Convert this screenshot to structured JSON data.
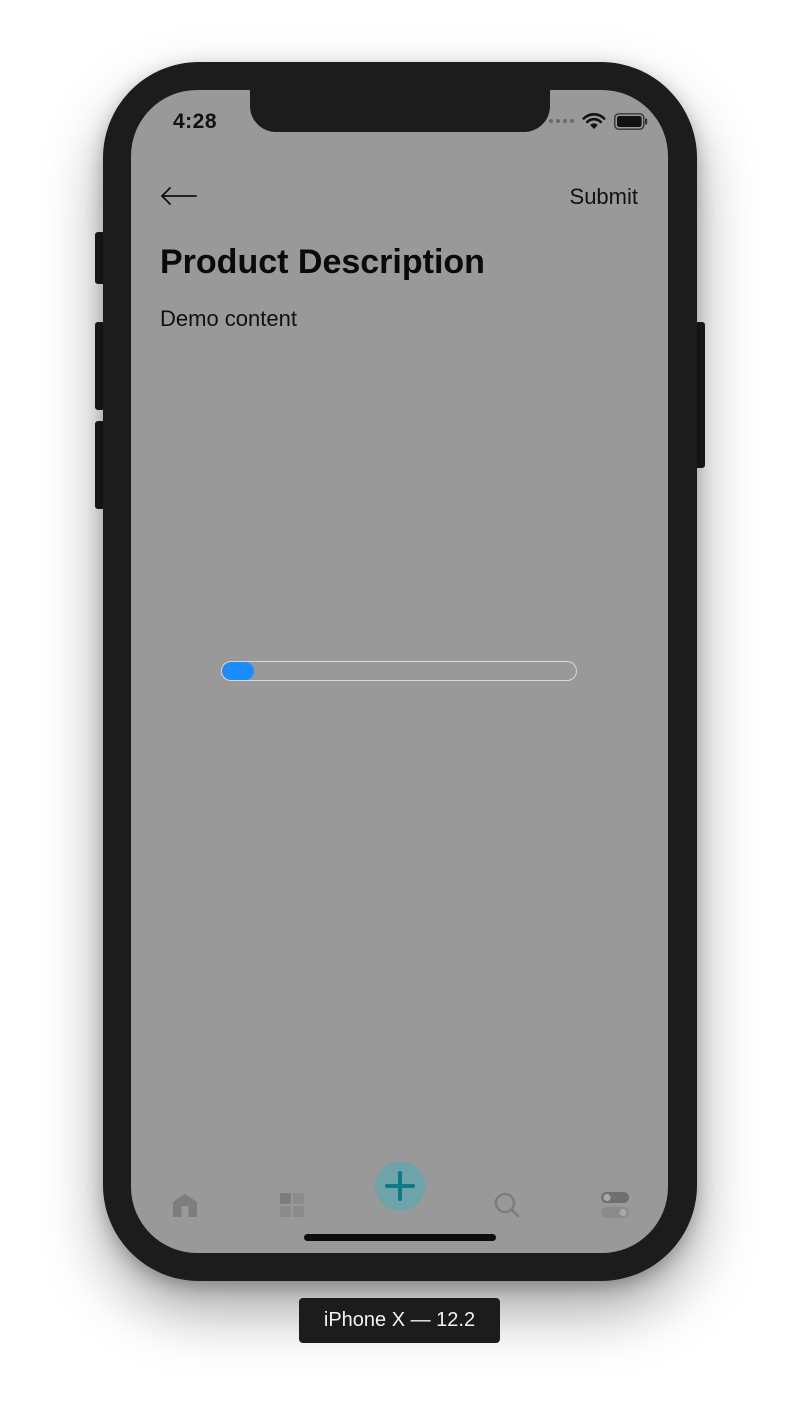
{
  "status_bar": {
    "time": "4:28",
    "icons": [
      "signal-dots-icon",
      "wifi-icon",
      "battery-icon"
    ]
  },
  "nav": {
    "back_icon": "arrow-left-icon",
    "submit_label": "Submit"
  },
  "content": {
    "title": "Product Description",
    "body": "Demo content"
  },
  "progress": {
    "value": 0.09,
    "color": "#1a8cff"
  },
  "tab_bar": {
    "tabs": [
      {
        "icon": "home-icon"
      },
      {
        "icon": "grid-icon"
      },
      {
        "icon": "plus-icon",
        "accent": "#0e7a85"
      },
      {
        "icon": "search-icon"
      },
      {
        "icon": "toggle-icon"
      }
    ]
  },
  "device_label": "iPhone X — 12.2"
}
